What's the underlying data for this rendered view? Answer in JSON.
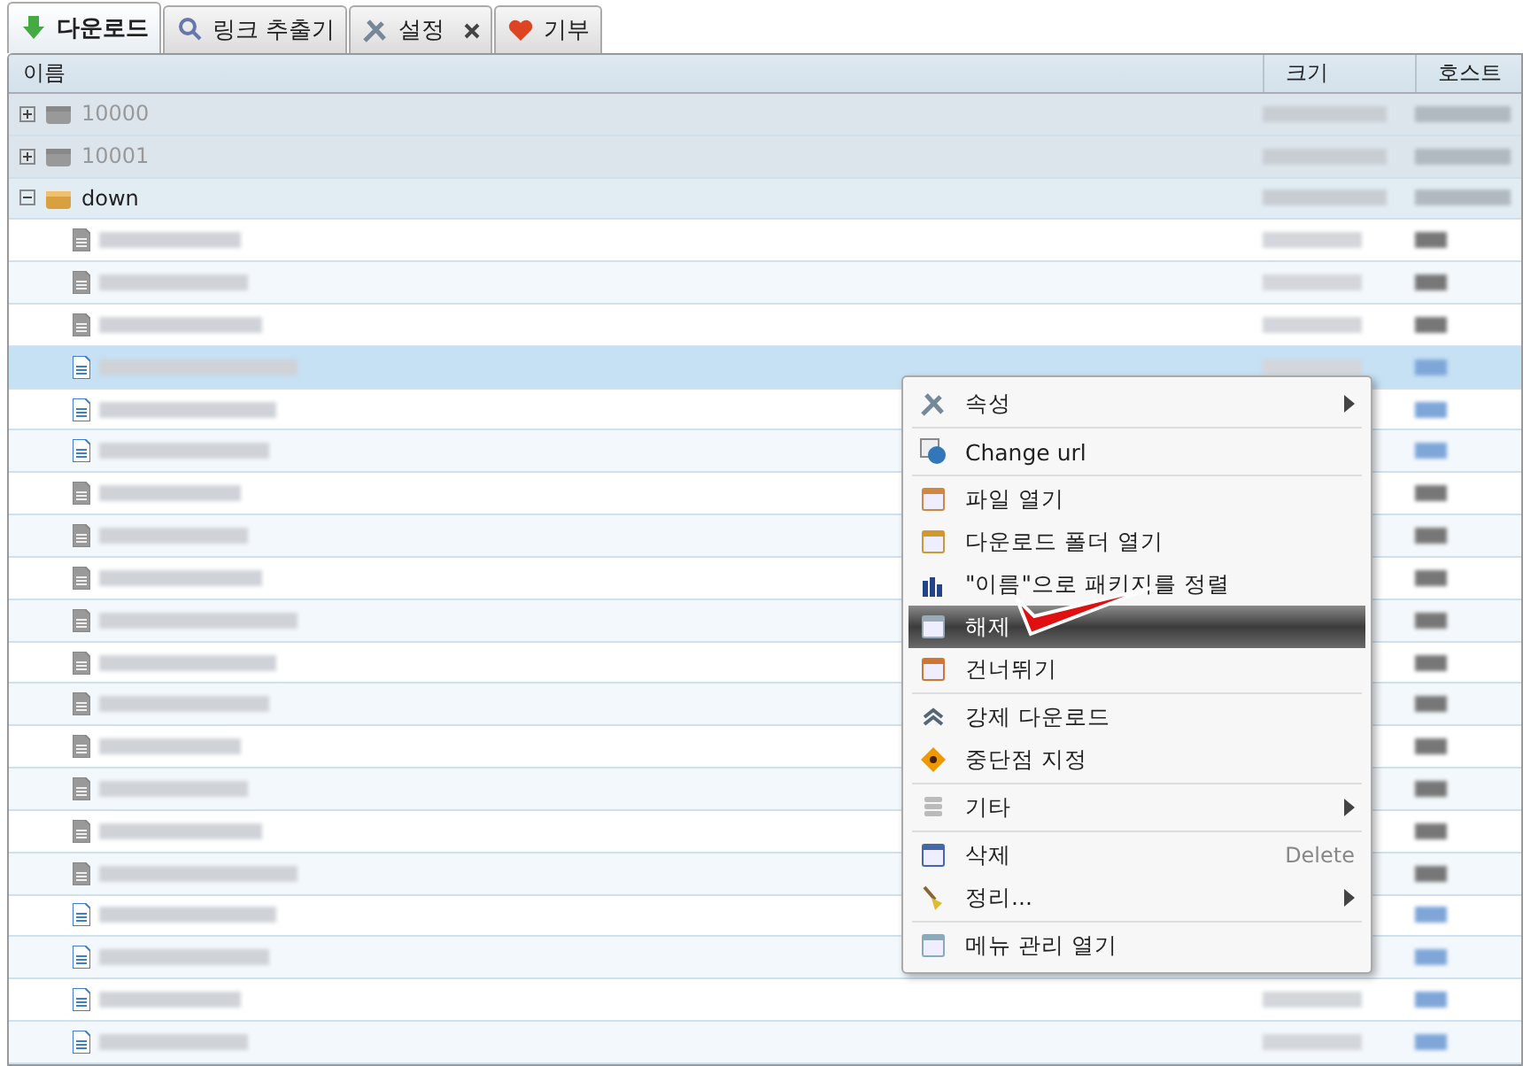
{
  "tabs": [
    {
      "label": "다운로드",
      "selected": true,
      "closable": false
    },
    {
      "label": "링크 추출기",
      "selected": false,
      "closable": false
    },
    {
      "label": "설정",
      "selected": false,
      "closable": true
    },
    {
      "label": "기부",
      "selected": false,
      "closable": false
    }
  ],
  "table": {
    "columns": [
      "이름",
      "크기",
      "호스트"
    ],
    "packages": [
      {
        "name": "10000",
        "expanded": false,
        "disabled": true
      },
      {
        "name": "10001",
        "expanded": false,
        "disabled": true
      },
      {
        "name": "down",
        "expanded": true,
        "disabled": false
      }
    ],
    "files": [
      {
        "kind": "gray",
        "selected": false
      },
      {
        "kind": "gray",
        "selected": false
      },
      {
        "kind": "gray",
        "selected": false
      },
      {
        "kind": "blue",
        "selected": true
      },
      {
        "kind": "blue",
        "selected": false
      },
      {
        "kind": "blue",
        "selected": false
      },
      {
        "kind": "gray",
        "selected": false
      },
      {
        "kind": "gray",
        "selected": false
      },
      {
        "kind": "gray",
        "selected": false
      },
      {
        "kind": "gray",
        "selected": false
      },
      {
        "kind": "gray",
        "selected": false
      },
      {
        "kind": "gray",
        "selected": false
      },
      {
        "kind": "gray",
        "selected": false
      },
      {
        "kind": "gray",
        "selected": false
      },
      {
        "kind": "gray",
        "selected": false
      },
      {
        "kind": "gray",
        "selected": false
      },
      {
        "kind": "blue",
        "selected": false
      },
      {
        "kind": "blue",
        "selected": false
      },
      {
        "kind": "blue",
        "selected": false
      },
      {
        "kind": "blue",
        "selected": false
      }
    ]
  },
  "context_menu": [
    {
      "kind": "item",
      "label": "속성",
      "submenu": true,
      "selected": false
    },
    {
      "kind": "separator"
    },
    {
      "kind": "item",
      "label": "Change url",
      "submenu": false,
      "selected": false
    },
    {
      "kind": "separator"
    },
    {
      "kind": "item",
      "label": "파일 열기",
      "submenu": false,
      "selected": false
    },
    {
      "kind": "item",
      "label": "다운로드 폴더 열기",
      "submenu": false,
      "selected": false
    },
    {
      "kind": "item",
      "label": "\"이름\"으로 패키지를 정렬",
      "submenu": false,
      "selected": false
    },
    {
      "kind": "item",
      "label": "해제",
      "submenu": false,
      "selected": true
    },
    {
      "kind": "item",
      "label": "건너뛰기",
      "submenu": false,
      "selected": false
    },
    {
      "kind": "separator"
    },
    {
      "kind": "item",
      "label": "강제 다운로드",
      "submenu": false,
      "selected": false
    },
    {
      "kind": "item",
      "label": "중단점 지정",
      "submenu": false,
      "selected": false
    },
    {
      "kind": "separator"
    },
    {
      "kind": "item",
      "label": "기타",
      "submenu": true,
      "selected": false
    },
    {
      "kind": "separator"
    },
    {
      "kind": "item",
      "label": "삭제",
      "shortcut": "Delete",
      "submenu": false,
      "selected": false
    },
    {
      "kind": "item",
      "label": "정리...",
      "submenu": true,
      "selected": false
    },
    {
      "kind": "separator"
    },
    {
      "kind": "item",
      "label": "메뉴 관리 열기",
      "submenu": false,
      "selected": false
    }
  ]
}
